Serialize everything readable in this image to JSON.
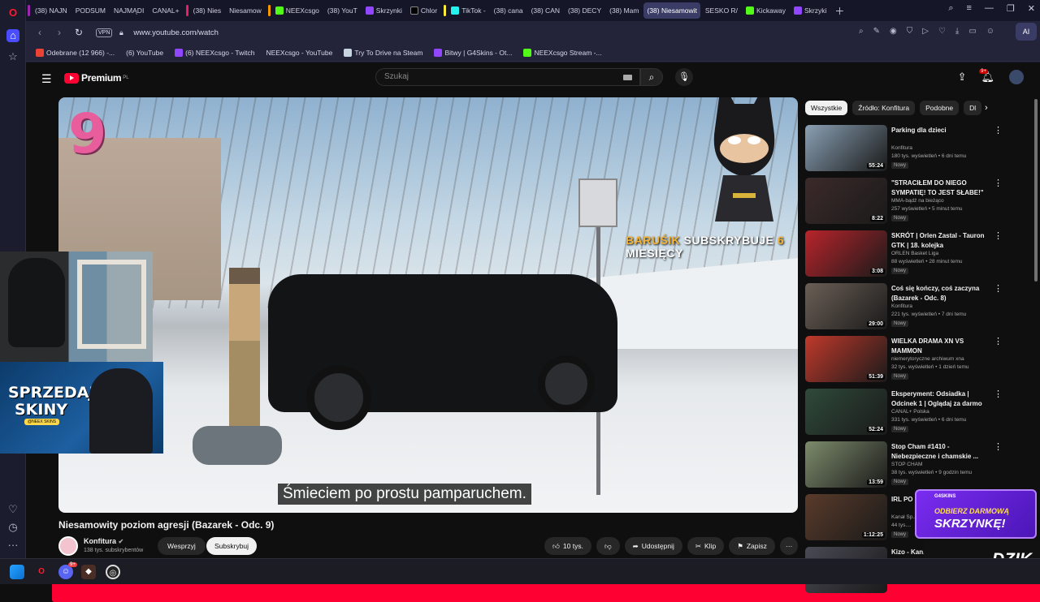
{
  "browser": {
    "tabs": [
      {
        "label": "(38) NAJN",
        "icon": "youtube-icon"
      },
      {
        "label": "PODSUM",
        "icon": "youtube-icon"
      },
      {
        "label": "NAJMĄDI",
        "icon": "youtube-icon"
      },
      {
        "label": "CANAL+",
        "icon": "youtube-icon"
      },
      {
        "label": "(38) Nies",
        "icon": "youtube-icon"
      },
      {
        "label": "Niesamow",
        "icon": "youtube-icon"
      },
      {
        "label": "NEEXcsgo",
        "icon": "kick-icon"
      },
      {
        "label": "(38) YouT",
        "icon": "youtube-icon"
      },
      {
        "label": "Skrzynki",
        "icon": "purple-icon"
      },
      {
        "label": "Chlor",
        "icon": "x-icon"
      },
      {
        "label": "TikTok - ",
        "icon": "tiktok-icon"
      },
      {
        "label": "(38) cana",
        "icon": "youtube-icon"
      },
      {
        "label": "(38) CAN",
        "icon": "youtube-icon"
      },
      {
        "label": "(38) DECY",
        "icon": "youtube-icon"
      },
      {
        "label": "(38) Mam",
        "icon": "youtube-icon"
      },
      {
        "label": "(38) Niesamowit",
        "icon": "youtube-icon",
        "active": true
      },
      {
        "label": "SESKO R/",
        "icon": "youtube-icon"
      },
      {
        "label": "Kickaway",
        "icon": "kick-icon"
      },
      {
        "label": "Skrzyki",
        "icon": "purple-icon"
      }
    ],
    "url": "www.youtube.com/watch",
    "vpn": "VPN",
    "ai_label": "AI",
    "bookmarks": [
      {
        "label": "Odebrane (12 966) -...",
        "icon": "gmail-icon"
      },
      {
        "label": "(6) YouTube",
        "icon": "youtube-icon"
      },
      {
        "label": "(6) NEEXcsgo - Twitch",
        "icon": "twitch-icon"
      },
      {
        "label": "NEEXcsgo - YouTube",
        "icon": "youtube-icon"
      },
      {
        "label": "Try To Drive na Steam",
        "icon": "steam-icon"
      },
      {
        "label": "Bitwy | G4Skins - Ot...",
        "icon": "purple-icon"
      },
      {
        "label": "NEEXcsgo Stream -...",
        "icon": "kick-icon"
      }
    ]
  },
  "youtube": {
    "logo_text": "Premium",
    "logo_region": "PL",
    "search_placeholder": "Szukaj",
    "notif_count": "9+",
    "video": {
      "title": "Niesamowity poziom agresji (Bazarek - Odc. 9)",
      "episode_number": "9",
      "overlay_name": "BARUŚIK",
      "overlay_mid": "SUBSKRYBUJE",
      "overlay_num": "6",
      "overlay_tail": "MIESIĘCY",
      "subtitle": "Śmieciem po prostu pamparuchem.",
      "promo_line1": "SPRZEDAJ",
      "promo_line2": "SKINY",
      "promo_pill": "@NEEX SKINS",
      "channel": "Konfitura",
      "subscribers": "138 tys. subskrybentów",
      "support_label": "Wesprzyj",
      "subscribe_label": "Subskrybuj",
      "likes": "10 tys.",
      "share_label": "Udostępnij",
      "clip_label": "Klip",
      "save_label": "Zapisz"
    },
    "chips": [
      {
        "label": "Wszystkie",
        "active": true
      },
      {
        "label": "Źródło: Konfitura"
      },
      {
        "label": "Podobne"
      },
      {
        "label": "Dl"
      }
    ],
    "recommendations": [
      {
        "title": "Parking dla dzieci",
        "channel": "Konfitura",
        "meta": "180 tys. wyświetleń • 6 dni temu",
        "badge": "Nowy",
        "duration": "55:24",
        "thumb": "#8aa0b4"
      },
      {
        "title": "\"STRACIŁEM DO NIEGO SYMPATIĘ! TO JEST SŁABE!\" ...",
        "channel": "MMA-bądź na bieżąco",
        "meta": "257 wyświetleń • 5 minut temu",
        "badge": "Nowy",
        "duration": "8:22",
        "thumb": "#3c2a2a"
      },
      {
        "title": "SKRÓT | Orlen Zastal - Tauron GTK | 18. kolejka",
        "channel": "ORLEN Basket Liga",
        "meta": "88 wyświetleń • 28 minut temu",
        "badge": "Nowy",
        "duration": "3:08",
        "thumb": "#b8242b"
      },
      {
        "title": "Coś się kończy, coś zaczyna (Bazarek - Odc. 8)",
        "channel": "Konfitura",
        "meta": "221 tys. wyświetleń • 7 dni temu",
        "badge": "Nowy",
        "duration": "29:00",
        "thumb": "#6b5f56"
      },
      {
        "title": "WIELKA DRAMA XN VS MAMMON",
        "channel": "niemerytoryczne archiwum xna",
        "meta": "32 tys. wyświetleń • 1 dzień temu",
        "badge": "Nowy",
        "duration": "51:39",
        "thumb": "#c0392b"
      },
      {
        "title": "Eksperyment: Odsiadka | Odcinek 1 | Oglądaj za darmo",
        "channel": "CANAL+ Polska",
        "meta": "331 tys. wyświetleń • 6 dni temu",
        "badge": "Nowy",
        "duration": "52:24",
        "thumb": "#2f4a3a"
      },
      {
        "title": "Stop Cham #1410 - Niebezpieczne i chamskie ...",
        "channel": "STOP CHAM",
        "meta": "38 tys. wyświetleń • 9 godzin temu",
        "badge": "Nowy",
        "duration": "13:59",
        "thumb": "#7d8b6b"
      },
      {
        "title": "IRL PO FAME... ALBERT...",
        "channel": "Kanał Sp...",
        "meta": "44 tys....",
        "badge": "Nowy",
        "duration": "1:12:25",
        "thumb": "#5a3b2a"
      },
      {
        "title": "Kizo - Kan... S&M",
        "channel": "",
        "meta": "",
        "badge": "",
        "duration": "",
        "thumb": "#4a4a55"
      }
    ],
    "skr_line1": "ODBIERZ DARMOWĄ",
    "skr_line2": "SKRZYNKĘ!",
    "skr_brand": "G4SKINS",
    "dzik": "DZIK"
  },
  "taskbar": {
    "discord_badge": "9+"
  }
}
